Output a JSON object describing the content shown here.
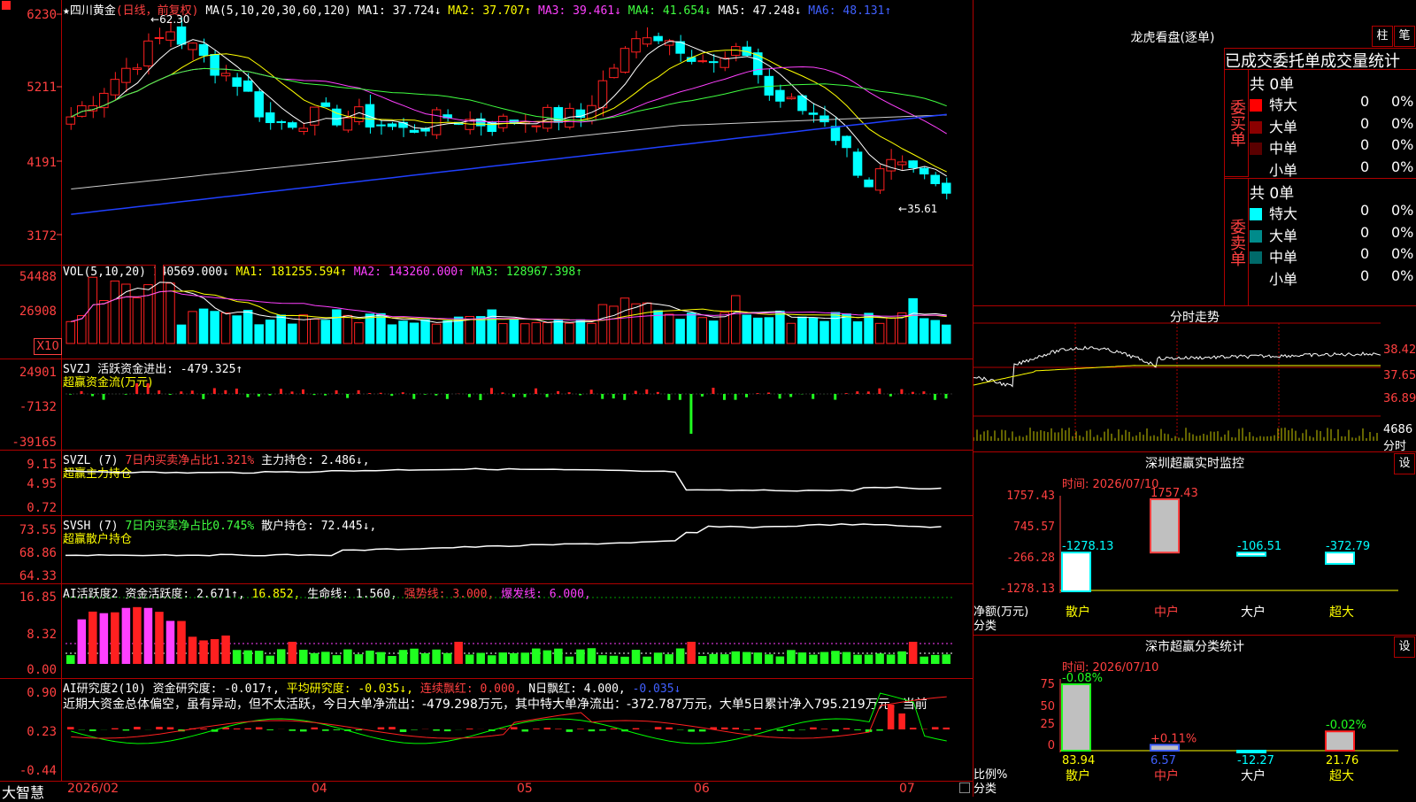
{
  "app": {
    "brand": "大智慧"
  },
  "kline": {
    "stock": "四川黄金",
    "period": "(日线，前复权)",
    "ma_label": "MA(5,10,20,30,60,120)",
    "ma": [
      {
        "label": "MA1: 37.724↓",
        "color": "#ffffff"
      },
      {
        "label": "MA2: 37.707↑",
        "color": "#ffff00"
      },
      {
        "label": "MA3: 39.461↓",
        "color": "#ff40ff"
      },
      {
        "label": "MA4: 41.654↓",
        "color": "#40ff40"
      },
      {
        "label": "MA5: 47.248↓",
        "color": "#ffffff"
      },
      {
        "label": "MA6: 48.131↑",
        "color": "#4060ff"
      }
    ],
    "yticks": [
      "6230",
      "5211",
      "4191",
      "3172"
    ],
    "high_label": "62.30",
    "low_label": "35.61"
  },
  "vol": {
    "title": "VOL(5,10,20)",
    "value": "140569.000↓",
    "ma1": "MA1: 181255.594↑",
    "ma2": "MA2: 143260.000↑",
    "ma3": "MA3: 128967.398↑",
    "yticks": [
      "54488",
      "26908"
    ],
    "unit": "X10"
  },
  "svzj": {
    "title": "SVZJ",
    "value": "活跃资金进出: -479.325↑",
    "sub": "超赢资金流(万元)",
    "yticks": [
      "24901",
      "-7132",
      "-39165"
    ]
  },
  "svzl": {
    "title": "SVZL (7)",
    "ratio": "7日内买卖净占比1.321%",
    "hold": "主力持仓: 2.486↓,",
    "sub": "超赢主力持仓",
    "yticks": [
      "9.15",
      "4.95",
      "0.72"
    ]
  },
  "svsh": {
    "title": "SVSH (7)",
    "ratio": "7日内买卖净占比0.745%",
    "hold": "散户持仓: 72.445↓,",
    "sub": "超赢散户持仓",
    "yticks": [
      "73.55",
      "68.86",
      "64.33"
    ]
  },
  "ai1": {
    "title": "AI活跃度2",
    "active": "资金活跃度: 2.671↑,",
    "v2": "16.852,",
    "life": "生命线: 1.560,",
    "strong": "强势线: 3.000,",
    "burst": "爆发线: 6.000,",
    "yticks": [
      "16.85",
      "8.32",
      "0.00"
    ]
  },
  "ai2": {
    "title": "AI研究度2(10)",
    "research": "资金研究度: -0.017↑,",
    "avg": "平均研究度: -0.035↓,",
    "streak": "连续飘红: 0.000,",
    "nday": "N日飘红: 4.000,",
    "last": "-0.035↓",
    "comment": "近期大资金总体偏空，虽有异动，但不太活跃，今日大单净流出：-479.298万元，其中特大单净流出：-372.787万元，大单5日累计净入795.219万元，当前",
    "yticks": [
      "0.90",
      "0.23",
      "-0.44"
    ]
  },
  "xaxis": {
    "labels": [
      "2026/02",
      "04",
      "05",
      "06",
      "07"
    ]
  },
  "dragon": {
    "title": "龙虎看盘(逐单)",
    "btn1": "柱",
    "btn2": "笔",
    "header": "已成交委托单成交量统计",
    "buy_label": "委买单",
    "sell_label": "委卖单",
    "buy_total": "共 0单",
    "sell_total": "共 0单",
    "buy_rows": [
      {
        "name": "特大",
        "v": "0",
        "p": "0%",
        "color": "#ff0000"
      },
      {
        "name": "大单",
        "v": "0",
        "p": "0%",
        "color": "#8b0000"
      },
      {
        "name": "中单",
        "v": "0",
        "p": "0%",
        "color": "#5a0000"
      },
      {
        "name": "小单",
        "v": "0",
        "p": "0%",
        "color": "#000000"
      }
    ],
    "sell_rows": [
      {
        "name": "特大",
        "v": "0",
        "p": "0%",
        "color": "#00ffff"
      },
      {
        "name": "大单",
        "v": "0",
        "p": "0%",
        "color": "#008b8b"
      },
      {
        "name": "中单",
        "v": "0",
        "p": "0%",
        "color": "#006a6a"
      },
      {
        "name": "小单",
        "v": "0",
        "p": "0%",
        "color": "#000000"
      }
    ]
  },
  "intraday": {
    "title": "分时走势",
    "yticks": [
      "38.42",
      "37.65",
      "36.89"
    ],
    "vol_top": "4686",
    "vol_unit": "分时"
  },
  "szmon": {
    "title": "深圳超赢实时监控",
    "btn": "设",
    "time": "时间: 2026/07/10",
    "yticks": [
      "1757.43",
      "745.57",
      "-266.28",
      "-1278.13"
    ],
    "ylabel": "净额(万元)",
    "xlabel": "分类",
    "categories": [
      "散户",
      "中户",
      "大户",
      "超大"
    ],
    "values_text": [
      "-1278.13",
      "1757.43",
      "-106.51",
      "-372.79"
    ]
  },
  "szcls": {
    "title": "深市超赢分类统计",
    "btn": "设",
    "time": "时间: 2026/07/10",
    "yticks": [
      "75",
      "50",
      "25",
      "0"
    ],
    "ylabel": "比例%",
    "xlabel": "分类",
    "categories": [
      "散户",
      "中户",
      "大户",
      "超大"
    ],
    "top_text": [
      "-0.08%",
      "+0.11%",
      "",
      "-0.02%"
    ],
    "bottom_text": [
      "83.94",
      "6.57",
      "-12.27",
      "21.76"
    ]
  },
  "chart_data": [
    {
      "type": "bar",
      "title": "深圳超赢实时监控",
      "categories": [
        "散户",
        "中户",
        "大户",
        "超大"
      ],
      "values": [
        -1278.13,
        1757.43,
        -106.51,
        -372.79
      ],
      "ylabel": "净额(万元)",
      "xlabel": "分类",
      "ylim": [
        -1278.13,
        1757.43
      ]
    },
    {
      "type": "bar",
      "title": "深市超赢分类统计",
      "categories": [
        "散户",
        "中户",
        "大户",
        "超大"
      ],
      "values": [
        83.94,
        6.57,
        -12.27,
        21.76
      ],
      "ylabel": "比例%",
      "xlabel": "分类",
      "ylim": [
        0,
        75
      ]
    }
  ],
  "colors": {
    "up": "#ff2020",
    "down": "#00ffff",
    "grid": "#b00000",
    "axis": "#ff4040"
  }
}
